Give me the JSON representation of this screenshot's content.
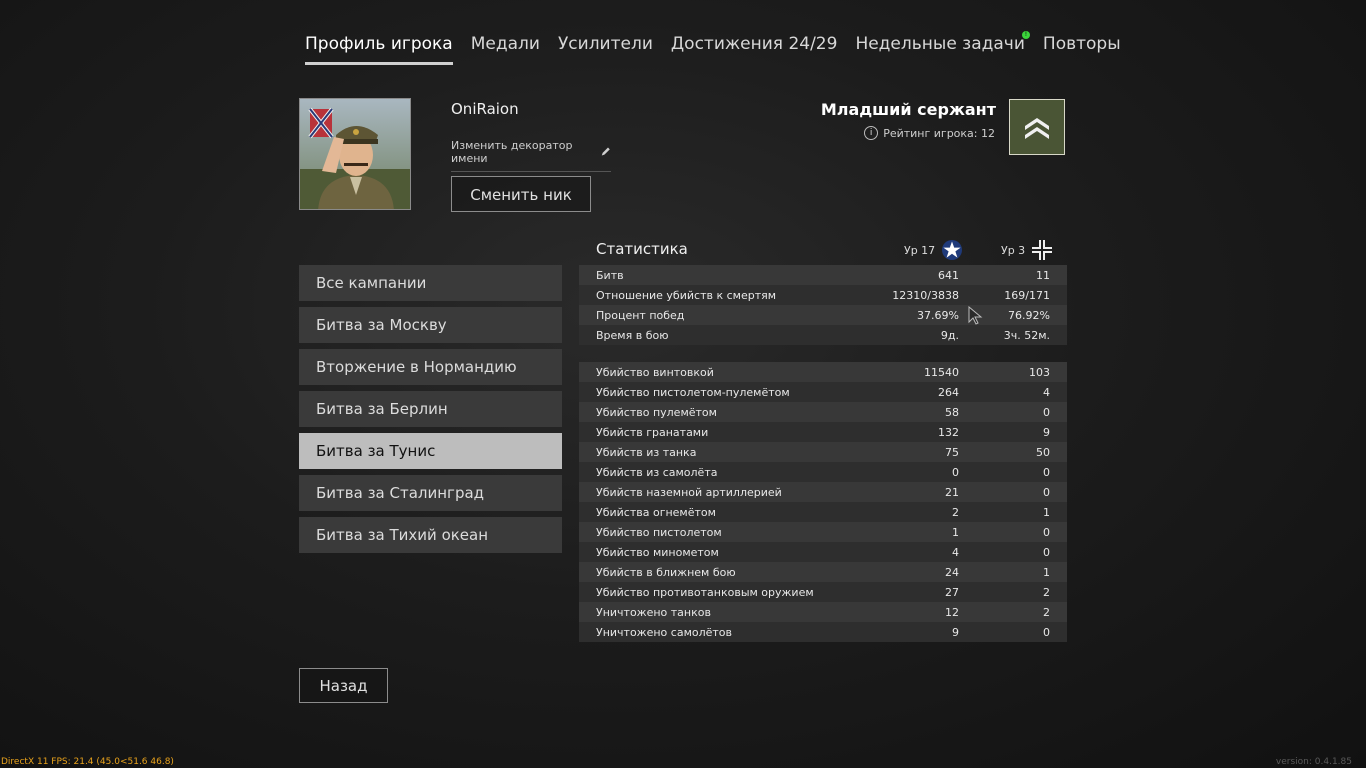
{
  "tabs": [
    {
      "label": "Профиль игрока"
    },
    {
      "label": "Медали"
    },
    {
      "label": "Усилители"
    },
    {
      "label": "Достижения 24/29"
    },
    {
      "label": "Недельные задачи"
    },
    {
      "label": "Повторы"
    }
  ],
  "profile": {
    "name": "OniRaion",
    "decorator_label": "Изменить декоратор имени",
    "change_nick_label": "Сменить ник",
    "rank": "Младший сержант",
    "rating": "Рейтинг игрока: 12"
  },
  "campaigns": [
    {
      "label": "Все кампании"
    },
    {
      "label": "Битва за Москву"
    },
    {
      "label": "Вторжение в Нормандию"
    },
    {
      "label": "Битва за Берлин"
    },
    {
      "label": "Битва за Тунис"
    },
    {
      "label": "Битва за Сталинград"
    },
    {
      "label": "Битва за Тихий океан"
    }
  ],
  "stats": {
    "title": "Статистика",
    "level1": "Ур 17",
    "level2": "Ур 3",
    "general": [
      {
        "label": "Битв",
        "v1": "641",
        "v2": "11"
      },
      {
        "label": "Отношение убийств к смертям",
        "v1": "12310/3838",
        "v2": "169/171"
      },
      {
        "label": "Процент побед",
        "v1": "37.69%",
        "v2": "76.92%"
      },
      {
        "label": "Время в бою",
        "v1": "9д.",
        "v2": "3ч. 52м."
      }
    ],
    "kills": [
      {
        "label": "Убийство винтовкой",
        "v1": "11540",
        "v2": "103"
      },
      {
        "label": "Убийство пистолетом-пулемётом",
        "v1": "264",
        "v2": "4"
      },
      {
        "label": "Убийство пулемётом",
        "v1": "58",
        "v2": "0"
      },
      {
        "label": "Убийств гранатами",
        "v1": "132",
        "v2": "9"
      },
      {
        "label": "Убийств из танка",
        "v1": "75",
        "v2": "50"
      },
      {
        "label": "Убийств из самолёта",
        "v1": "0",
        "v2": "0"
      },
      {
        "label": "Убийств наземной артиллерией",
        "v1": "21",
        "v2": "0"
      },
      {
        "label": "Убийства огнемётом",
        "v1": "2",
        "v2": "1"
      },
      {
        "label": "Убийство пистолетом",
        "v1": "1",
        "v2": "0"
      },
      {
        "label": "Убийство минометом",
        "v1": "4",
        "v2": "0"
      },
      {
        "label": "Убийств в ближнем бою",
        "v1": "24",
        "v2": "1"
      },
      {
        "label": "Убийство противотанковым оружием",
        "v1": "27",
        "v2": "2"
      },
      {
        "label": "Уничтожено танков",
        "v1": "12",
        "v2": "2"
      },
      {
        "label": "Уничтожено самолётов",
        "v1": "9",
        "v2": "0"
      }
    ]
  },
  "back_label": "Назад",
  "footer": {
    "left": "DirectX 11 FPS: 21.4 (45.0<51.6 46.8)",
    "right": "version: 0.4.1.85"
  },
  "colors": {
    "active_campaign_bg": "#bdbdbd",
    "notification_dot": "#3bd43b",
    "rank_badge_bg": "#4a5535",
    "fps_text": "#e8a21c"
  }
}
